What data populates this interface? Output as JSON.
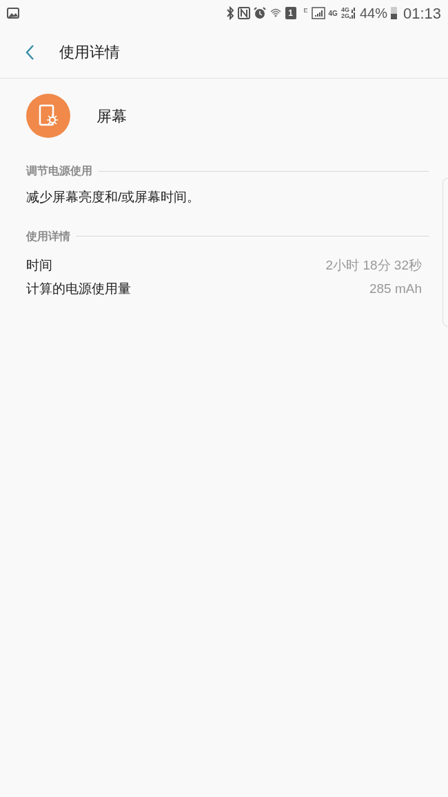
{
  "status_bar": {
    "sim": "1",
    "net_e": "E",
    "net_4g": "4G",
    "net_4g_2": "4G",
    "net_2g": "2G",
    "battery": "44%",
    "time": "01:13"
  },
  "header": {
    "title": "使用详情"
  },
  "app": {
    "name": "屏幕"
  },
  "sections": [
    {
      "title": "调节电源使用",
      "kind": "text",
      "text": "减少屏幕亮度和/或屏幕时间。"
    },
    {
      "title": "使用详情",
      "kind": "rows",
      "rows": [
        {
          "label": "时间",
          "value": "2小时 18分 32秒"
        },
        {
          "label": "计算的电源使用量",
          "value": "285 mAh"
        }
      ]
    }
  ]
}
